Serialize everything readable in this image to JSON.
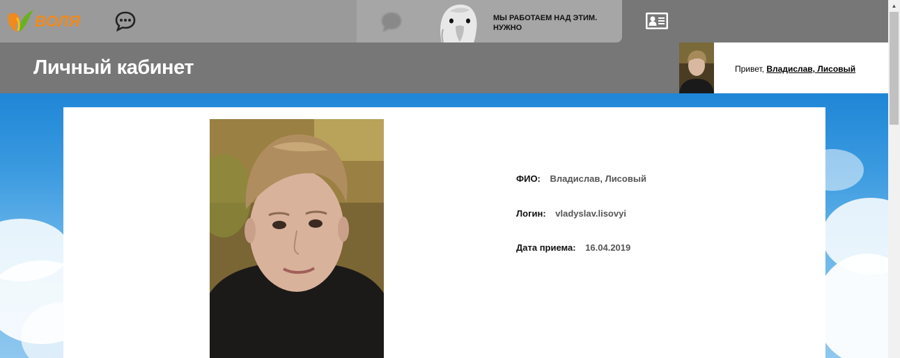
{
  "topbar": {
    "logo_text": "ВОЛЯ",
    "banner_text": "МЫ РАБОТАЕМ НАД ЭТИМ. НУЖНО"
  },
  "header": {
    "title": "Личный кабинет",
    "greeting_prefix": "Привет,",
    "user_name": "Владислав, Лисовый"
  },
  "profile": {
    "fields": [
      {
        "label": "ФИО:",
        "value": "Владислав, Лисовый"
      },
      {
        "label": "Логин:",
        "value": "vladyslav.lisovyi"
      },
      {
        "label": "Дата приема:",
        "value": "16.04.2019"
      }
    ]
  },
  "icons": {
    "logo": "volia-logo",
    "chat": "chat-bubble-icon",
    "profile_card": "profile-card-icon"
  },
  "colors": {
    "topbar": "#777777",
    "logo_orange": "#f08a1c",
    "logo_green": "#6ab023",
    "background_sky": "#2a8fdc"
  }
}
